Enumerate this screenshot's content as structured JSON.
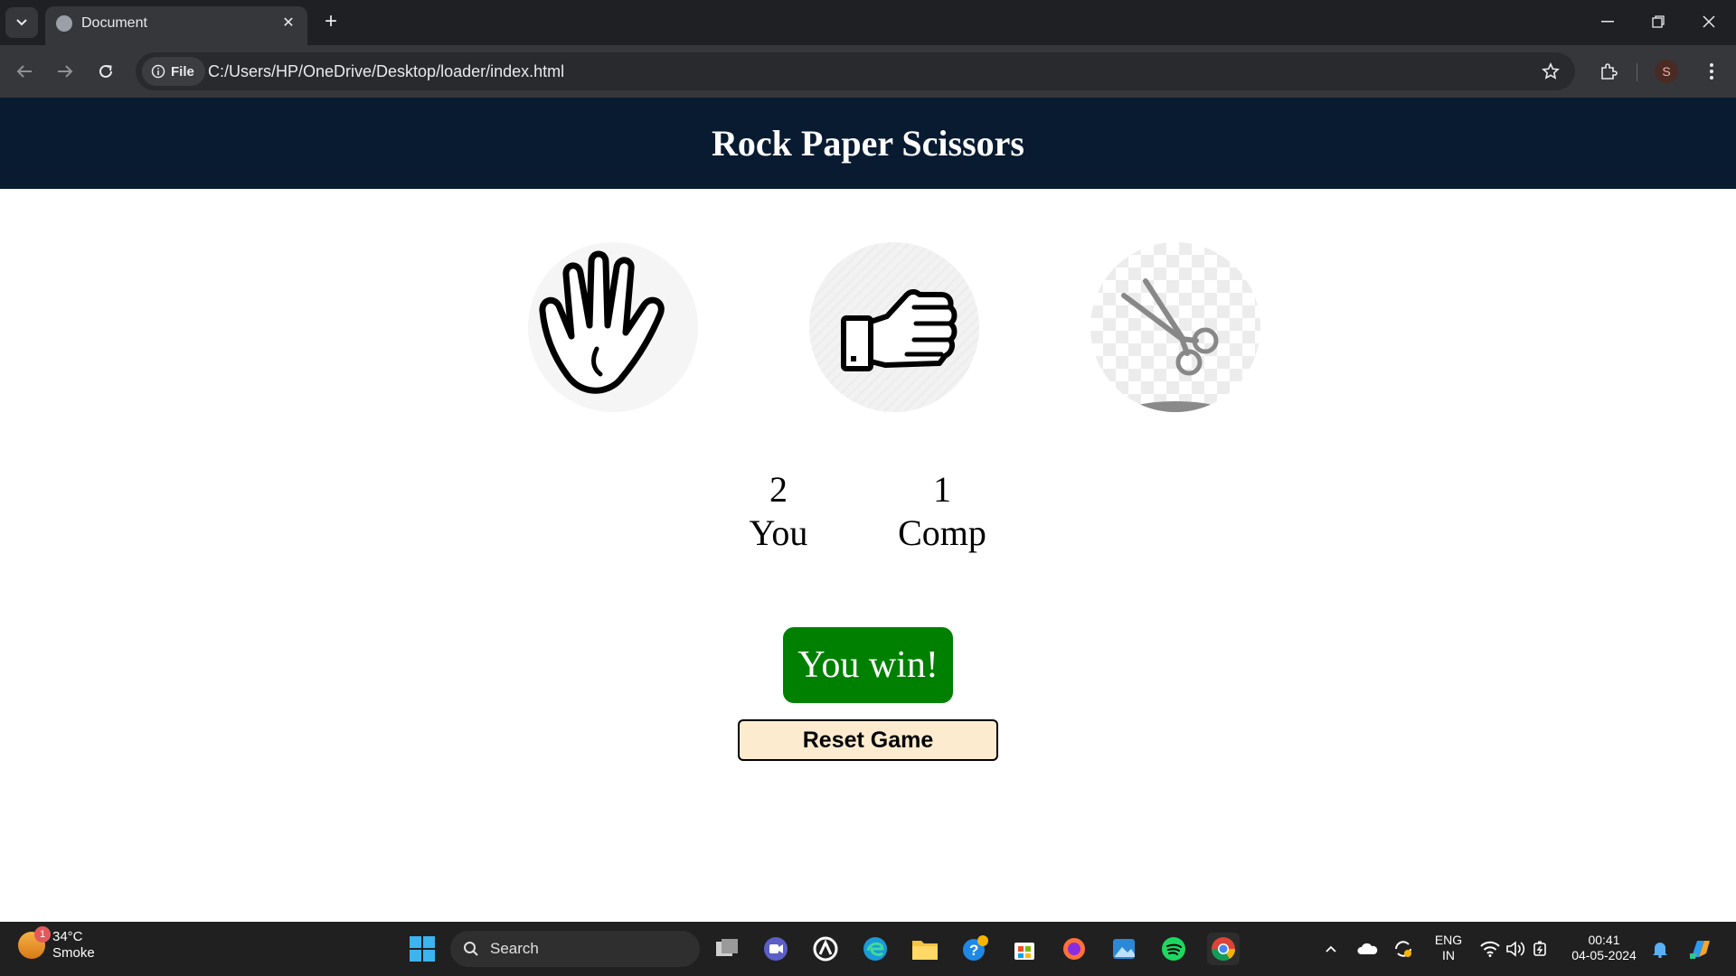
{
  "browser": {
    "tab_title": "Document",
    "tab_close": "✕",
    "new_tab": "+",
    "site_chip": "File",
    "url": "C:/Users/HP/OneDrive/Desktop/loader/index.html",
    "profile_initial": "S"
  },
  "page": {
    "heading": "Rock Paper Scissors",
    "choices": [
      {
        "name": "paper",
        "icon": "hand-paper-icon"
      },
      {
        "name": "rock",
        "icon": "fist-rock-icon"
      },
      {
        "name": "scissors",
        "icon": "scissors-icon"
      }
    ],
    "scores": {
      "user_score": "2",
      "user_label": "You",
      "comp_score": "1",
      "comp_label": "Comp"
    },
    "message": "You win!",
    "message_color": "#008000",
    "reset_label": "Reset Game",
    "header_color": "#081b31"
  },
  "taskbar": {
    "weather_badge": "1",
    "temperature": "34°C",
    "condition": "Smoke",
    "search_label": "Search",
    "lang_top": "ENG",
    "lang_bottom": "IN",
    "time": "00:41",
    "date": "04-05-2024"
  }
}
